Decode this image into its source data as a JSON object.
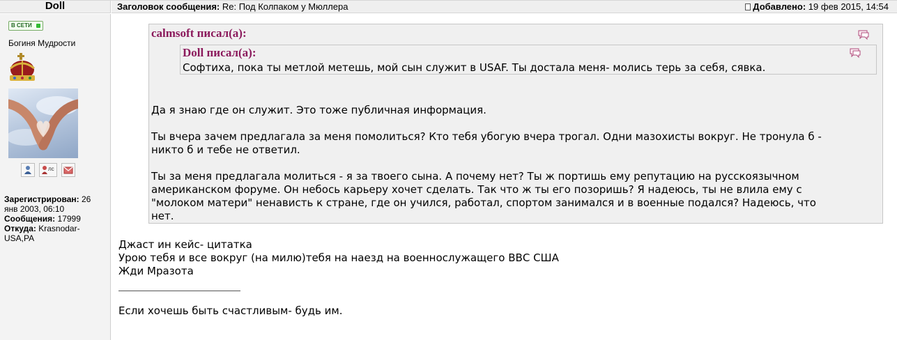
{
  "header": {
    "username": "Doll",
    "subject_label": "Заголовок сообщения:",
    "subject_value": "Re: Под Колпаком у Мюллера",
    "added_label": "Добавлено:",
    "added_value": "19 фев 2015, 14:54"
  },
  "profile": {
    "online_badge": "В СЕТИ",
    "rank": "Богиня Мудрости",
    "buttons": {
      "pm_label": "лс"
    },
    "registered_label": "Зарегистрирован:",
    "registered_value_1": "26",
    "registered_value_2": "янв 2003, 06:10",
    "messages_label": "Сообщения:",
    "messages_value": "17999",
    "from_label": "Откуда:",
    "from_value_1": "Krasnodar-",
    "from_value_2": "USA,PA"
  },
  "message": {
    "outer_quote": {
      "author": "calmsoft писал(а):",
      "inner_quote": {
        "author": "Doll писал(а):",
        "text": "Софтиха, пока ты метлой метешь, мой сын служит в USAF. Ты достала меня- молись терь за себя, сявка."
      },
      "para1": "Да я знаю где он служит. Это тоже публичная информация.",
      "para2_line1": "Ты вчера зачем предлагала за меня помолиться? Кто тебя убогую вчера трогал. Одни мазохисты вокруг. Не тронула б -",
      "para2_line2": "никто б и тебе не ответил.",
      "para3_line1": "Ты за меня предлагала молиться - я за твоего сына. А почему нет? Ты ж портишь ему репутацию на русскоязычном",
      "para3_line2": "американском форуме. Он небось карьеру хочет сделать. Так что ж ты его позоришь? Я надеюсь, ты не влила ему с",
      "para3_line3": "\"молоком матери\" ненависть к стране, где он учился, работал, спортом занимался и в военные подался? Надеюсь, что",
      "para3_line4": "нет."
    },
    "line1": "Джаст ин кейс- цитатка",
    "line2": "Урою тебя и все вокруг (на милю)тебя на наезд на военнослужащего ВВС США",
    "line3": "Жди Мразота",
    "signature": "Если хочешь быть счастливым- будь им."
  },
  "colors": {
    "quote_author": "#8b1a5c",
    "quote_bg": "#f0f0f0",
    "profile_bg": "#f3f3f3",
    "online_green": "#33bb33"
  }
}
